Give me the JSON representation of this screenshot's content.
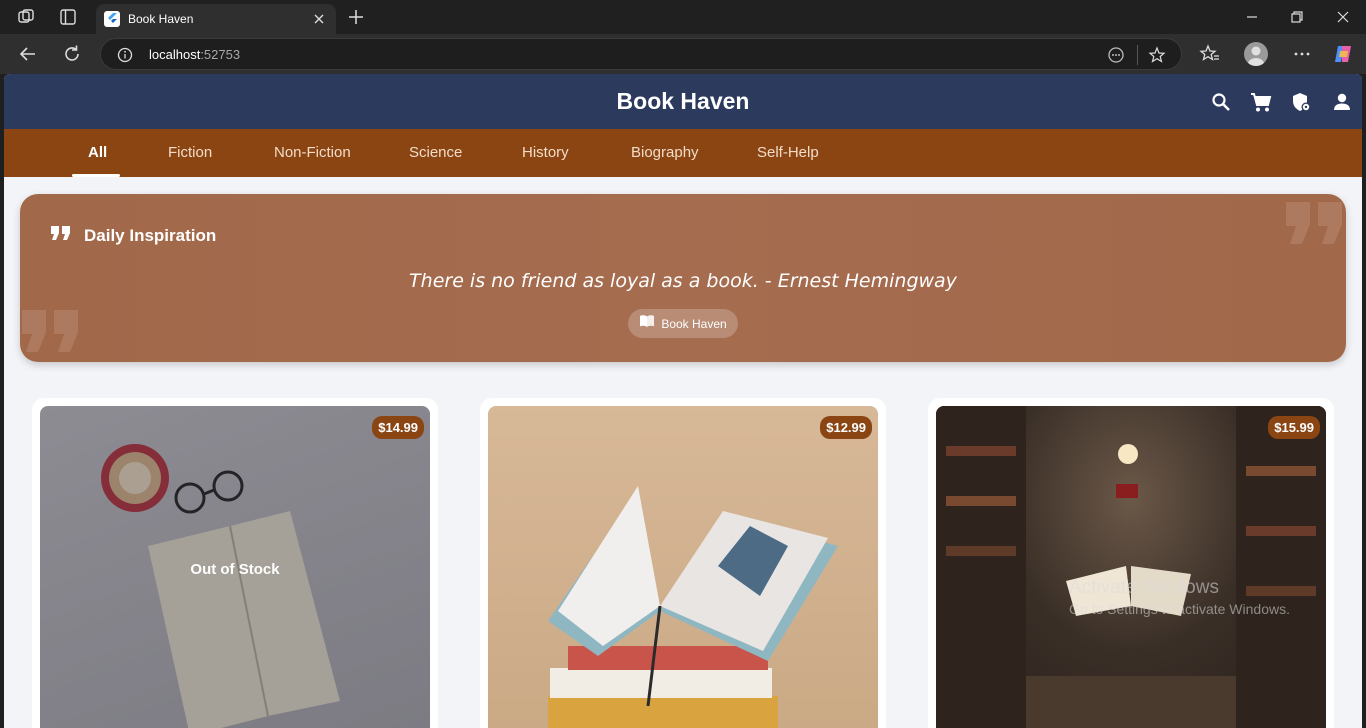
{
  "browser": {
    "tab_title": "Book Haven",
    "url_host": "localhost",
    "url_port": ":52753"
  },
  "app": {
    "title": "Book Haven",
    "icons": [
      "search-icon",
      "cart-icon",
      "shield-icon",
      "account-icon"
    ]
  },
  "categories": {
    "items": [
      "All",
      "Fiction",
      "Non-Fiction",
      "Science",
      "History",
      "Biography",
      "Self-Help"
    ],
    "selected": "All"
  },
  "quote": {
    "heading": "Daily Inspiration",
    "text": "There is no friend as loyal as a book. - Ernest Hemingway",
    "badge": "Book Haven"
  },
  "products": [
    {
      "price": "$14.99",
      "status": "Out of Stock"
    },
    {
      "price": "$12.99"
    },
    {
      "price": "$15.99"
    }
  ],
  "watermark": {
    "line1": "Activate Windows",
    "line2": "Go to Settings to activate Windows."
  },
  "colors": {
    "appbar": "#2c3a5e",
    "category_bar": "#8a4513",
    "quote_card": "#a56c4f",
    "price_badge": "#8a4513",
    "page_bg": "#f3f4f8"
  }
}
